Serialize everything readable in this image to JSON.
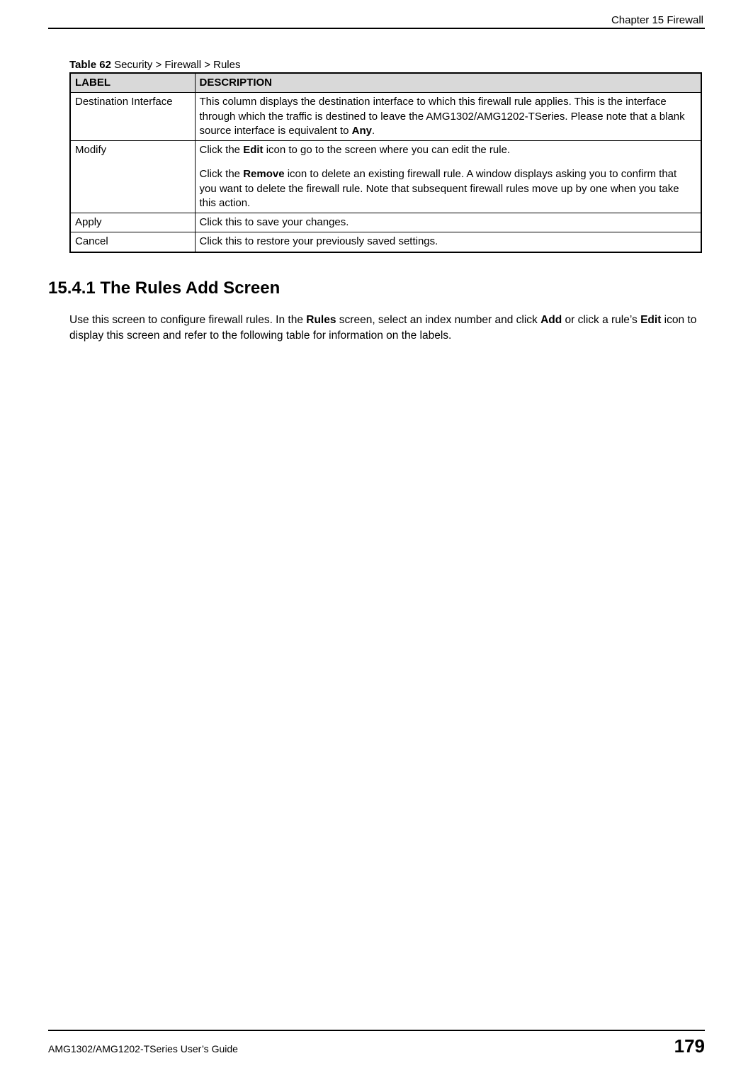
{
  "header": {
    "chapter": "Chapter 15 Firewall"
  },
  "table": {
    "caption_prefix": "Table 62",
    "caption_rest": "   Security > Firewall > Rules",
    "headers": {
      "label": "LABEL",
      "description": "DESCRIPTION"
    },
    "rows": {
      "r0": {
        "label": "Destination Interface",
        "desc_pre": "This column displays the destination interface to which this firewall rule applies. This is the interface through which the traffic is destined to leave the AMG1302/AMG1202-TSeries. Please note that a blank source interface is equivalent to ",
        "desc_bold": "Any",
        "desc_post": "."
      },
      "r1": {
        "label": "Modify",
        "p1_pre": "Click the ",
        "p1_b1": "Edit",
        "p1_post": " icon to go to the screen where you can edit the rule.",
        "p2_pre": "Click the ",
        "p2_b1": "Remove",
        "p2_post": " icon to delete an existing firewall rule. A window displays asking you to confirm that you want to delete the firewall rule. Note that subsequent firewall rules move up by one when you take this action."
      },
      "r2": {
        "label": "Apply",
        "desc": "Click this to save your changes."
      },
      "r3": {
        "label": "Cancel",
        "desc": "Click this to restore your previously saved settings."
      }
    }
  },
  "section": {
    "heading": "15.4.1  The Rules Add Screen",
    "body_pre": "Use this screen to configure firewall rules. In the ",
    "body_b1": "Rules",
    "body_mid1": " screen, select an index number and click ",
    "body_b2": "Add",
    "body_mid2": " or click a rule’s ",
    "body_b3": "Edit",
    "body_post": " icon to display this screen and refer to the following table for information on the labels."
  },
  "footer": {
    "guide": "AMG1302/AMG1202-TSeries User’s Guide",
    "page": "179"
  }
}
